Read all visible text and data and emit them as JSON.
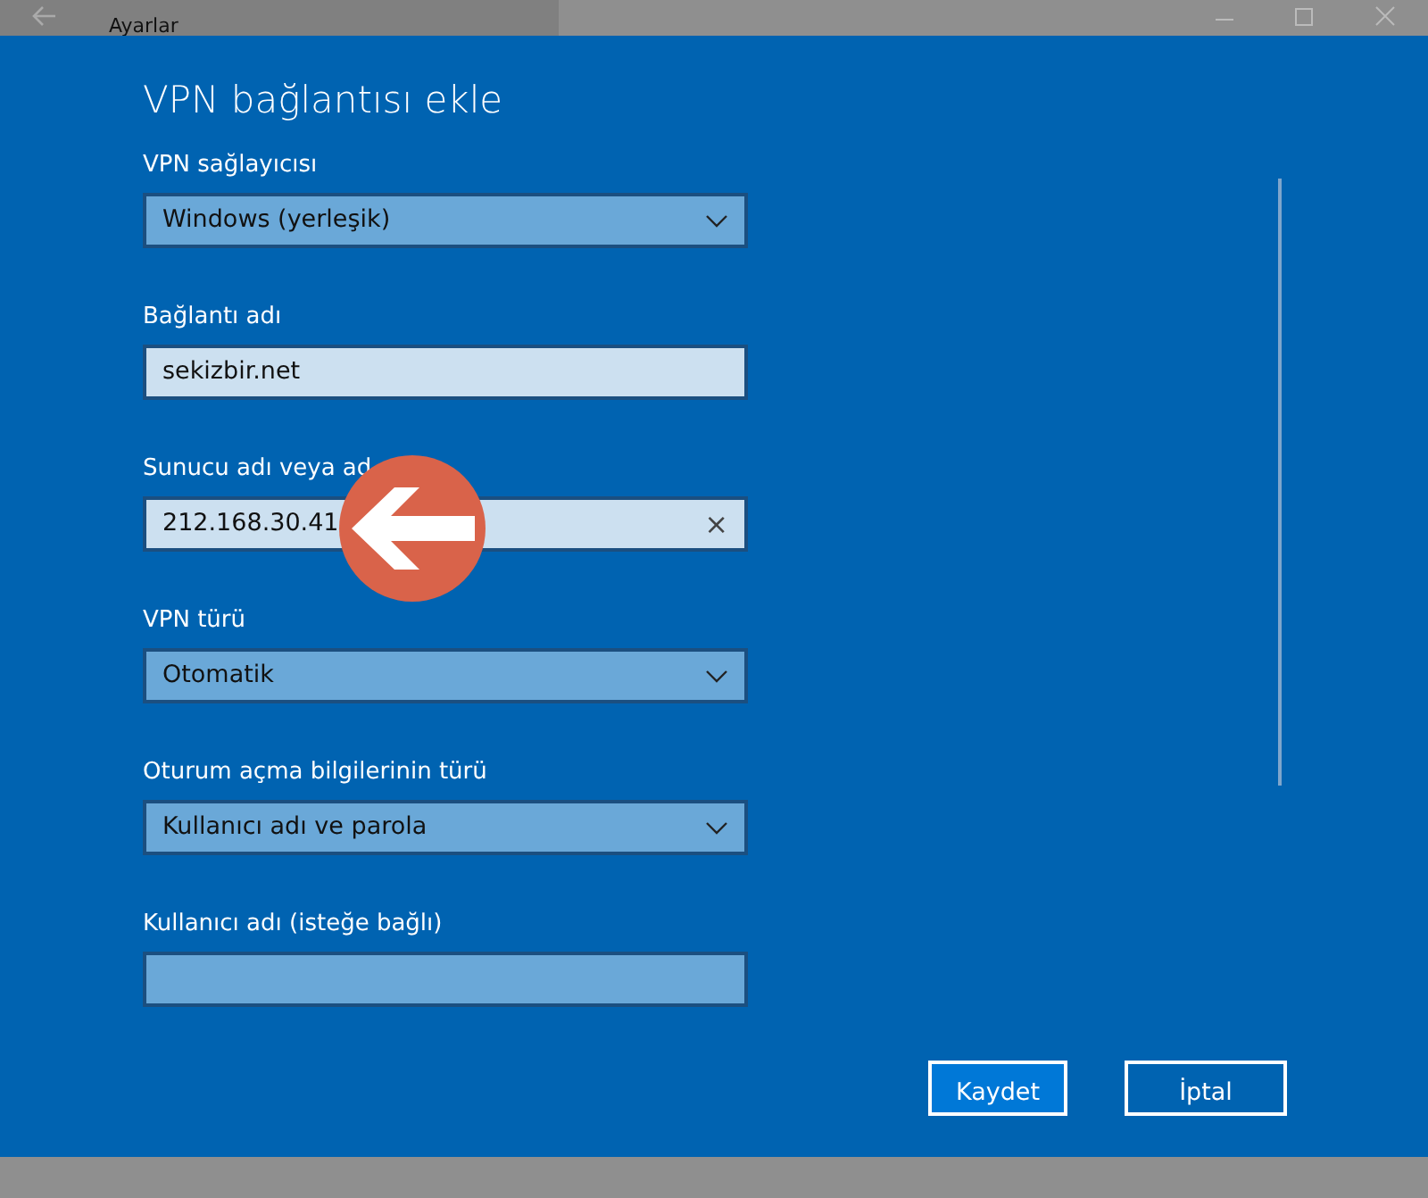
{
  "window": {
    "title": "Ayarlar"
  },
  "dialog": {
    "title": "VPN bağlantısı ekle",
    "fields": [
      {
        "kind": "dropdown",
        "label": "VPN sağlayıcısı",
        "value": "Windows (yerleşik)"
      },
      {
        "kind": "text",
        "label": "Bağlantı adı",
        "value": "sekizbir.net"
      },
      {
        "kind": "text",
        "label": "Sunucu adı veya ad",
        "value": "212.168.30.41",
        "clear": "×",
        "annotated": true
      },
      {
        "kind": "dropdown",
        "label": "VPN türü",
        "value": "Otomatik"
      },
      {
        "kind": "dropdown",
        "label": "Oturum açma bilgilerinin türü",
        "value": "Kullanıcı adı ve parola"
      },
      {
        "kind": "text",
        "label": "Kullanıcı adı (isteğe bağlı)",
        "empty": true
      }
    ],
    "buttons": [
      {
        "label": "Kaydet",
        "kind": "primary"
      },
      {
        "label": "İptal",
        "kind": "secondary"
      }
    ]
  }
}
